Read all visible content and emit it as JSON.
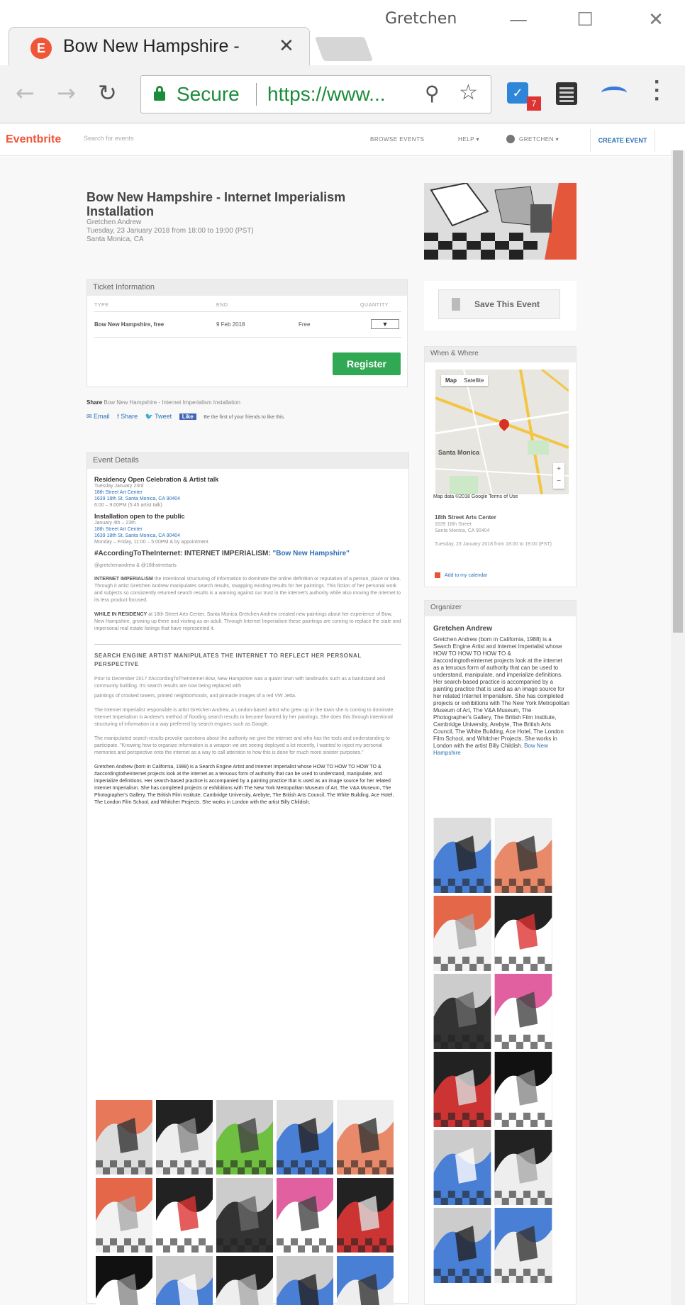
{
  "browser": {
    "profile_name": "Gretchen",
    "tab": {
      "title": "Bow New Hampshire - In",
      "title_fade": "t"
    },
    "address": {
      "secure_label": "Secure",
      "url": "https://www..."
    },
    "extension_badge": "7",
    "icons": [
      "back-icon",
      "forward-icon",
      "reload-icon",
      "lock-icon",
      "zoom-icon",
      "star-icon",
      "todo-extension-icon",
      "filmstrip-extension-icon",
      "arc-extension-icon",
      "menu-icon",
      "minimize-icon",
      "maximize-icon",
      "close-icon"
    ]
  },
  "eventbrite": {
    "logo": "Eventbrite",
    "search_placeholder": "Search for events",
    "nav": {
      "browse": "BROWSE EVENTS",
      "help": "HELP ▾",
      "user": "GRETCHEN ▾",
      "create": "CREATE EVENT"
    }
  },
  "event": {
    "title": "Bow New Hampshire - Internet Imperialism Installation",
    "organizer": "Gretchen Andrew",
    "datetime": "Tuesday, 23 January 2018 from 18:00 to 19:00 (PST)",
    "location": "Santa Monica, CA"
  },
  "ticket": {
    "heading": "Ticket Information",
    "cols": {
      "type": "TYPE",
      "end": "END",
      "quantity": "QUANTITY"
    },
    "row": {
      "type": "Bow New Hampshire, free",
      "end": "9 Feb 2018",
      "price": "Free",
      "qty": "▼"
    },
    "register": "Register"
  },
  "share": {
    "label": "Share",
    "text": "Bow New Hampshire - Internet Imperialism Installation",
    "email": "✉ Email",
    "share": "f Share",
    "tweet": "🐦 Tweet",
    "like": "Like",
    "like_text": "Be the first of your friends to like this."
  },
  "details": {
    "heading": "Event Details",
    "s1_title": "Residency Open Celebration & Artist talk",
    "s1_lines": [
      "Tuesday January 23rd",
      "18th Street Art Center",
      "1639 18th St, Santa Monica, CA 90404",
      "6:00 – 9:00PM (5:45 artist talk)"
    ],
    "s2_title": "Installation open to the public",
    "s2_lines": [
      "January 4th – 23th",
      "18th Street Art Center",
      "1639 18th St, Santa Monica, CA 90404",
      "Monday – Friday, 11:00 – 5:00PM & by appointment"
    ],
    "hashtag": "#AccordingToTheInternet: INTERNET IMPERIALISM: ",
    "hashtag_link": "\"Bow New Hampshire\"",
    "handles": "@gretchenandrew & @18thstreetarts",
    "p1_bold": "INTERNET IMPERIALISM",
    "p1": " the intentional structuring of information to dominate the online definition or reputation of a person, place or idea. Through it artist Gretchen Andrew manipulates search results, swapping existing results for her paintings. This fiction of her personal work and subjects so consistently returned search results is a warning against our trust in the internet's authority while also moving the internet to its less product focused.",
    "p2_bold": "WHILE IN RESIDENCY",
    "p2": " at 18th Street Arts Center, Santa Monica Gretchen Andrew created new paintings about her experience of Bow, New Hampshire, growing up there and visiting as an adult. Through Internet Imperialism these paintings are coming to replace the stale and impersonal real estate listings that have represented it.",
    "cap": "SEARCH ENGINE ARTIST MANIPULATES THE INTERNET TO REFLECT HER PERSONAL PERSPECTIVE",
    "p3": "Prior to December 2017 #AccordingToTheInternet Bow, New Hampshire was a quaint town with landmarks such as a bandstand and community building. It's search results are now being replaced with",
    "p4": "paintings of crooked towers, printed neighborhoods, and pinnacle images of a red VW Jetta.",
    "p5": "The Internet Imperialist responsible is artist Gretchen Andrew, a London-based artist who grew up in the town she is coming to dominate. Internet Imperialism is Andrew's method of flooding search results to become favored by her paintings. She does this through intentional structuring of information in a way preferred by search engines such as Google.",
    "p6": "The manipulated search results provoke questions about the authority we give the internet and who has the tools and understanding to participate. \"Knowing how to organize information is a weapon we are seeing deployed a lot recently, I wanted to inject my personal memories and perspective onto the internet as a way to call attention to how this is done for much more sinister purposes.\"",
    "p7": "Gretchen Andrew (born in California, 1988) is a Search Engine Artist and Internet Imperialist whose HOW TO HOW TO HOW TO & #accordingtotheinternet projects look at the internet as a tenuous form of authority that can be used to understand, manipulate, and imperialize definitions. Her search-based practice is accompanied by a painting practice that is used as an image source for her related Internet Imperialism. She has completed projects or exhibitions with The New York Metropolitan Museum of Art, The V&A Museum, The Photographer's Gallery, The British Film Institute, Cambridge University, Arebyte, The British Arts Council, The White Building, Ace Hotel, The London Film School, and Whitcher Projects. She works in London with the artist Billy Childish."
  },
  "sidebar": {
    "save_label": "Save This Event",
    "when_heading": "When & Where",
    "map_tab_map": "Map",
    "map_tab_sat": "Satellite",
    "map_city": "Santa Monica",
    "map_footer": "Map data ©2018 Google   Terms of Use",
    "venue_name": "18th Street Arts Center",
    "venue_addr1": "1639 18th Street",
    "venue_addr2": "Santa Monica, CA 90404",
    "venue_time": "Tuesday, 23 January 2018 from 18:00 to 19:00 (PST)",
    "add_calendar": "Add to my calendar",
    "organizer_heading": "Organizer",
    "org_name": "Gretchen Andrew",
    "org_bio": "Gretchen Andrew (born in California, 1988) is a Search Engine Artist and Internet Imperialist whose HOW TO HOW TO HOW TO & #accordingtotheinternet projects look at the internet as a tenuous form of authority that can be used to understand, manipulate, and imperialize definitions. Her search-based practice is accompanied by a painting practice that is used as an image source for her related Internet Imperialism. She has completed projects or exhibitions with The New York Metropolitan Museum of Art, The V&A Museum, The Photographer's Gallery, The British Film Institute, Cambridge University, Arebyte, The British Arts Council, The White Building, Ace Hotel, The London Film School, and Whitcher Projects. She works in London with the artist Billy Childish.",
    "org_link": "Bow New Hampshire"
  },
  "colors": {
    "brand": "#f05537",
    "register": "#31a853",
    "link": "#2b6fb6",
    "secure": "#1a8c3a"
  }
}
